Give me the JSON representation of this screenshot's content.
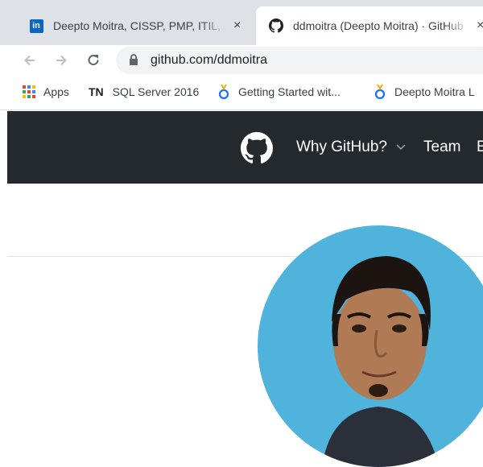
{
  "tabs": [
    {
      "title": "Deepto Moitra, CISSP, PMP, ITIL, ...",
      "close": "×",
      "icon": "linkedin-icon",
      "favicon_text": "in"
    },
    {
      "title": "ddmoitra (Deepto Moitra) · GitHub",
      "close": "×",
      "icon": "github-icon"
    }
  ],
  "toolbar": {
    "url": "github.com/ddmoitra"
  },
  "bookmarks": [
    {
      "label": "Apps",
      "icon": "apps-grid-icon"
    },
    {
      "label": "SQL Server 2016",
      "icon_text": "TN"
    },
    {
      "label": "Getting Started wit...",
      "icon": "ring-icon"
    },
    {
      "label": "Deepto Moitra L",
      "icon": "ring-icon"
    }
  ],
  "github": {
    "nav": [
      {
        "label": "Why GitHub?"
      },
      {
        "label": "Team"
      },
      {
        "label": "E"
      }
    ]
  },
  "colors": {
    "tabstrip": "#dee1e6",
    "gh_header": "#24292e",
    "avatar_bg": "#4fb3dc",
    "linkedin": "#0a66c2"
  }
}
